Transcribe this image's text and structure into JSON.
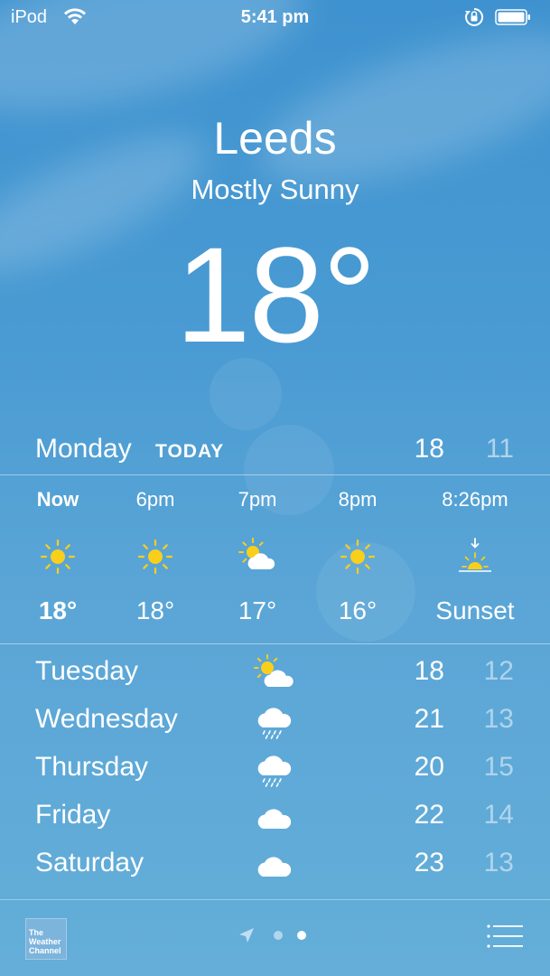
{
  "status_bar": {
    "carrier": "iPod",
    "time": "5:41 pm"
  },
  "location": {
    "city": "Leeds",
    "condition": "Mostly Sunny",
    "temperature": "18°"
  },
  "today": {
    "day": "Monday",
    "label": "TODAY",
    "high": "18",
    "low": "11"
  },
  "hourly": [
    {
      "time": "Now",
      "icon": "sun-icon",
      "temp": "18°"
    },
    {
      "time": "6pm",
      "icon": "sun-icon",
      "temp": "18°"
    },
    {
      "time": "7pm",
      "icon": "partly-cloudy-icon",
      "temp": "17°"
    },
    {
      "time": "8pm",
      "icon": "sun-icon",
      "temp": "16°"
    },
    {
      "time": "8:26pm",
      "icon": "sunset-icon",
      "temp": "Sunset"
    }
  ],
  "daily": [
    {
      "day": "Tuesday",
      "icon": "partly-cloudy-icon",
      "high": "18",
      "low": "12"
    },
    {
      "day": "Wednesday",
      "icon": "rain-cloud-icon",
      "high": "21",
      "low": "13"
    },
    {
      "day": "Thursday",
      "icon": "rain-cloud-icon",
      "high": "20",
      "low": "15"
    },
    {
      "day": "Friday",
      "icon": "cloud-icon",
      "high": "22",
      "low": "14"
    },
    {
      "day": "Saturday",
      "icon": "cloud-icon",
      "high": "23",
      "low": "13"
    }
  ],
  "footer": {
    "logo_text": "The Weather Channel"
  },
  "colors": {
    "sun": "#f9cf1b",
    "sky_top": "#3e92cf",
    "sky_bottom": "#64aed9"
  }
}
